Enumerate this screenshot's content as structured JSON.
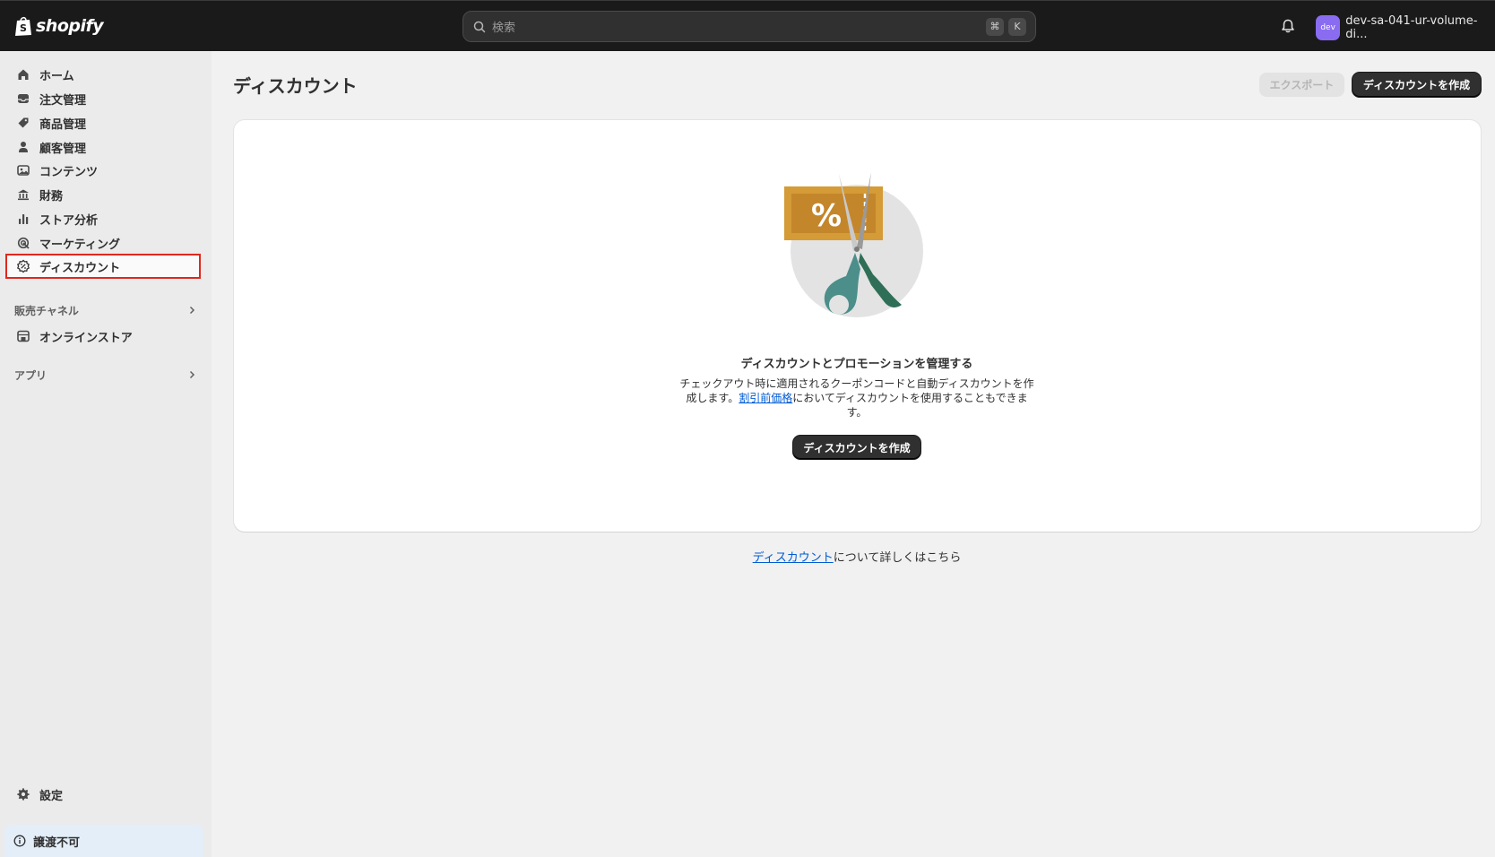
{
  "topbar": {
    "brand": "shopify",
    "search_placeholder": "検索",
    "shortcut_keys": [
      "⌘",
      "K"
    ],
    "avatar_text": "dev",
    "store_name": "dev-sa-041-ur-volume-di..."
  },
  "sidebar": {
    "items": [
      {
        "label": "ホーム",
        "icon": "home-icon"
      },
      {
        "label": "注文管理",
        "icon": "inbox-icon"
      },
      {
        "label": "商品管理",
        "icon": "tag-icon"
      },
      {
        "label": "顧客管理",
        "icon": "person-icon"
      },
      {
        "label": "コンテンツ",
        "icon": "image-icon"
      },
      {
        "label": "財務",
        "icon": "bank-icon"
      },
      {
        "label": "ストア分析",
        "icon": "bar-chart-icon"
      },
      {
        "label": "マーケティング",
        "icon": "target-icon"
      },
      {
        "label": "ディスカウント",
        "icon": "discount-icon",
        "active": true
      }
    ],
    "sales_channels_label": "販売チャネル",
    "online_store_label": "オンラインストア",
    "apps_label": "アプリ",
    "settings_label": "設定",
    "notice_label": "譲渡不可"
  },
  "main": {
    "title": "ディスカウント",
    "export_label": "エクスポート",
    "create_label": "ディスカウントを作成",
    "empty_state": {
      "heading": "ディスカウントとプロモーションを管理する",
      "desc_before": "チェックアウト時に適用されるクーポンコードと自動ディスカウントを作成します。",
      "desc_link": "割引前価格",
      "desc_after": "においてディスカウントを使用することもできます。",
      "button_label": "ディスカウントを作成"
    },
    "learn_link": "ディスカウント",
    "learn_suffix": "について詳しくはこちら"
  },
  "colors": {
    "topbar": "#1a1a1a",
    "sidebar": "#ebebeb",
    "page": "#f1f1f1",
    "highlight": "#e0281e",
    "link": "#005bd3",
    "primary_button": "#303030"
  }
}
